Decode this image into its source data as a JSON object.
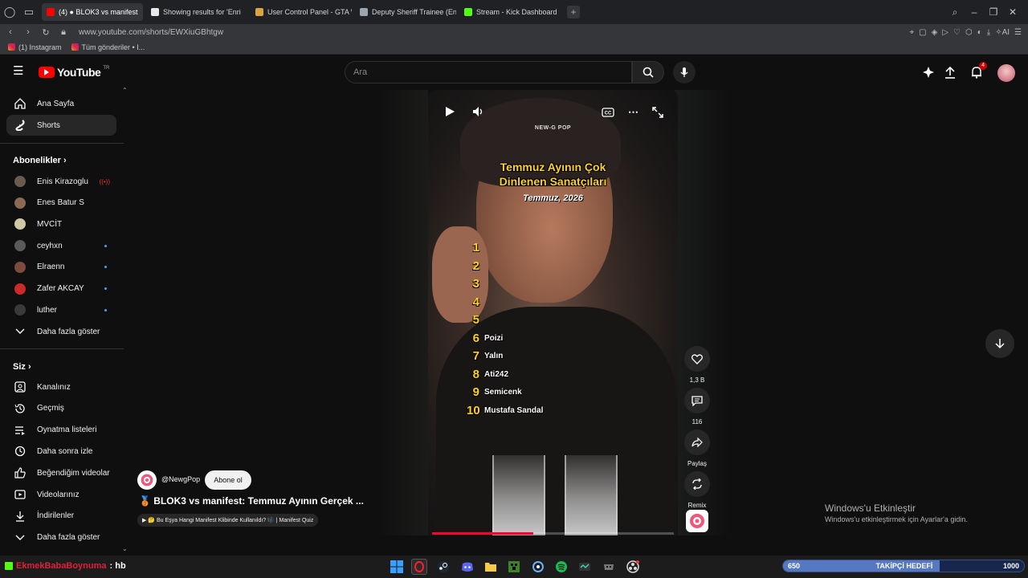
{
  "browser": {
    "tabs": [
      {
        "label": "(4) ● BLOK3 vs manifest",
        "badge": "(4)",
        "fav_color": "#ff0000",
        "active": true
      },
      {
        "label": "Showing results for 'Enri",
        "fav_color": "#e8e8e8",
        "active": false
      },
      {
        "label": "User Control Panel - GTA W",
        "fav_color": "#d9a441",
        "active": false
      },
      {
        "label": "Deputy Sheriff Trainee (En",
        "fav_color": "#9aa5b1",
        "active": false
      },
      {
        "label": "Stream - Kick Dashboard",
        "fav_color": "#53fc18",
        "active": false
      }
    ],
    "url": "www.youtube.com/shorts/EWXiuGBhtgw",
    "bookmarks": [
      {
        "label": "(1) Instagram"
      },
      {
        "label": "Tüm gönderiler • I..."
      }
    ]
  },
  "youtube": {
    "logo_text": "YouTube",
    "country": "TR",
    "search_placeholder": "Ara",
    "notification_count": "4"
  },
  "sidebar": {
    "main": [
      {
        "label": "Ana Sayfa",
        "icon": "home-icon"
      },
      {
        "label": "Shorts",
        "icon": "shorts-icon",
        "active": true
      }
    ],
    "subs_title": "Abonelikler",
    "subs": [
      {
        "label": "Enis Kirazoglu",
        "live": true,
        "color": "#6b5b4f"
      },
      {
        "label": "Enes Batur S",
        "live": false,
        "color": "#8a6a52"
      },
      {
        "label": "MVCİT",
        "live": false,
        "color": "#d0c9a5"
      },
      {
        "label": "ceyhxn",
        "dot": true,
        "color": "#5a5a5a"
      },
      {
        "label": "Elraenn",
        "dot": true,
        "color": "#7b4b3d"
      },
      {
        "label": "Zafer AKCAY",
        "dot": true,
        "color": "#cc2a2a"
      },
      {
        "label": "luther",
        "dot": true,
        "color": "#3a3a3a"
      }
    ],
    "subs_more": "Daha fazla göster",
    "you_title": "Siz",
    "you": [
      {
        "label": "Kanalınız",
        "icon": "channel-icon"
      },
      {
        "label": "Geçmiş",
        "icon": "history-icon"
      },
      {
        "label": "Oynatma listeleri",
        "icon": "playlists-icon"
      },
      {
        "label": "Daha sonra izle",
        "icon": "watch-later-icon"
      },
      {
        "label": "Beğendiğim videolar",
        "icon": "liked-icon"
      },
      {
        "label": "Videolarınız",
        "icon": "your-videos-icon"
      },
      {
        "label": "İndirilenler",
        "icon": "downloads-icon"
      },
      {
        "label": "Daha fazla göster",
        "icon": "chevron-down-icon"
      }
    ]
  },
  "short": {
    "brand": "NEW-G POP",
    "title_line1": "Temmuz Ayının Çok",
    "title_line2": "Dinlenen Sanatçıları",
    "date": "Temmuz, 2026",
    "ranking": [
      {
        "rank": "1",
        "name": ""
      },
      {
        "rank": "2",
        "name": ""
      },
      {
        "rank": "3",
        "name": ""
      },
      {
        "rank": "4",
        "name": ""
      },
      {
        "rank": "5",
        "name": ""
      },
      {
        "rank": "6",
        "name": "Poizi"
      },
      {
        "rank": "7",
        "name": "Yalın"
      },
      {
        "rank": "8",
        "name": "Ati242"
      },
      {
        "rank": "9",
        "name": "Semicenk"
      },
      {
        "rank": "10",
        "name": "Mustafa Sandal"
      }
    ],
    "progress": 0.42,
    "channel": "@NewgPop",
    "subscribe_label": "Abone ol",
    "title": "🥉 BLOK3 vs manifest: Temmuz Ayının Gerçek ...",
    "chip": "▶ 🤔 Bu Eşya Hangi Manifest Klibinde Kullanıldı? 🎼 | Manifest Quiz"
  },
  "actions": {
    "likes": "1,3 B",
    "comments": "116",
    "share": "Paylaş",
    "remix": "Remix"
  },
  "windows": {
    "line1": "Windows'u Etkinleştir",
    "line2": "Windows'u etkinleştirmek için Ayarlar'a gidin."
  },
  "stream": {
    "handle": "EkmekBabaBoynuma",
    "message": ": hb",
    "goal_current": "650",
    "goal_label": "TAKİPÇİ HEDEFİ",
    "goal_max": "1000",
    "goal_fraction": 0.65
  }
}
